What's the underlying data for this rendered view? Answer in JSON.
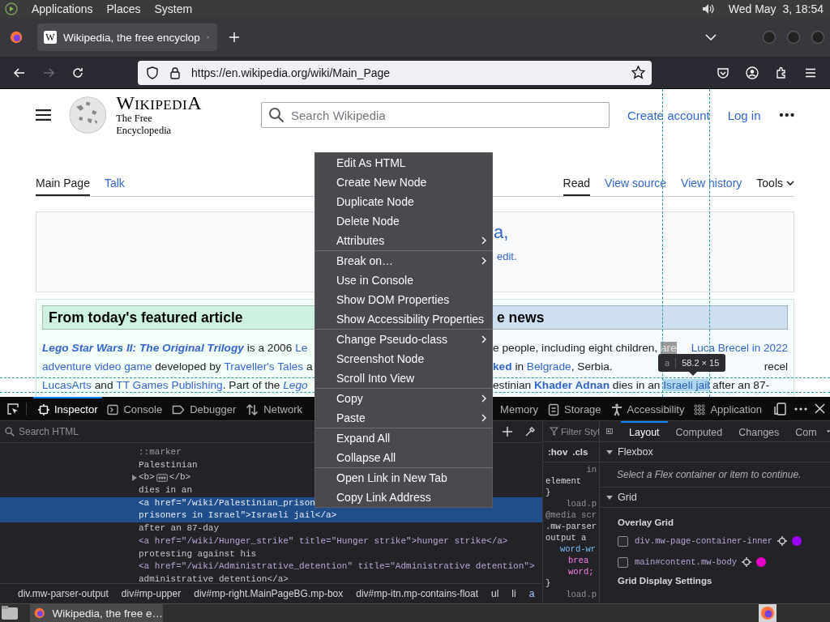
{
  "top_panel": {
    "menus": [
      "Applications",
      "Places",
      "System"
    ],
    "clock": "Wed May  3, 18:54"
  },
  "browser": {
    "tabs": [
      {
        "favicon": "W",
        "title": "Wikipedia, the free encyclop",
        "selected": true
      }
    ],
    "url": "https://en.wikipedia.org/wiki/Main_Page",
    "forward_disabled": true
  },
  "page": {
    "wordmark": "WikipediA",
    "tagline": "The Free Encyclopedia",
    "search_placeholder": "Search Wikipedia",
    "user_links": [
      "Create account",
      "Log in"
    ],
    "namespace_tabs": [
      {
        "label": "Main Page",
        "selected": true
      },
      {
        "label": "Talk",
        "selected": false
      }
    ],
    "view_tabs": [
      {
        "label": "Read",
        "selected": true
      },
      {
        "label": "View source",
        "selected": false
      },
      {
        "label": "View history",
        "selected": false
      }
    ],
    "tools_label": "Tools",
    "welcome_fragments": [
      "a,",
      "edit."
    ],
    "featured": {
      "heading": "From today's featured article",
      "lines": [
        [
          {
            "text": "Lego Star Wars II: The Original Trilogy",
            "kind": "featured"
          },
          {
            "text": " is a 2006 ",
            "kind": "plain"
          },
          {
            "text": "Le",
            "kind": "link"
          }
        ],
        [
          {
            "text": "adventure video game",
            "kind": "link"
          },
          {
            "text": " developed by ",
            "kind": "plain"
          },
          {
            "text": "Traveller's Tales",
            "kind": "link"
          },
          {
            "text": " a",
            "kind": "plain"
          }
        ],
        [
          {
            "text": "LucasArts",
            "kind": "link"
          },
          {
            "text": " and ",
            "kind": "plain"
          },
          {
            "text": "TT Games Publishing",
            "kind": "link"
          },
          {
            "text": ". Part of the ",
            "kind": "plain"
          },
          {
            "text": "Lego",
            "kind": "italic-link"
          }
        ]
      ]
    },
    "news": {
      "heading": "e news",
      "lines": [
        {
          "segments": [
            {
              "text": "e people, including eight children, ",
              "kind": "plain"
            },
            {
              "text": "are",
              "kind": "dim"
            }
          ],
          "caption": "Luca Brecel in 2022",
          "caption_is_link": true
        },
        {
          "segments": [
            {
              "text": "ked",
              "kind": "bold-link"
            },
            {
              "text": " in ",
              "kind": "plain"
            },
            {
              "text": "Belgrade",
              "kind": "link"
            },
            {
              "text": ", Serbia.",
              "kind": "plain"
            }
          ],
          "caption": "recel",
          "caption_is_link": false
        },
        {
          "segments": [
            {
              "text": "estinian ",
              "kind": "plain"
            },
            {
              "text": "Khader Adnan",
              "kind": "bold-link"
            },
            {
              "text": " dies in an ",
              "kind": "plain"
            },
            {
              "text": "Israeli jail",
              "kind": "inspected"
            },
            {
              "text": " after an 87-",
              "kind": "plain"
            }
          ]
        }
      ]
    }
  },
  "tooltip": {
    "tag": "a",
    "size": "58.2 × 15"
  },
  "devtools": {
    "tools_left": [
      {
        "label": "Inspector",
        "kind": "inspector",
        "selected": true
      },
      {
        "label": "Console",
        "kind": "console",
        "selected": false
      },
      {
        "label": "Debugger",
        "kind": "debugger",
        "selected": false
      },
      {
        "label": "Network",
        "kind": "network",
        "selected": false
      }
    ],
    "tools_right": [
      {
        "label": "Memory",
        "kind": "none",
        "selected": false
      },
      {
        "label": "Storage",
        "kind": "storage",
        "selected": false
      },
      {
        "label": "Accessibility",
        "kind": "accessibility",
        "selected": false
      },
      {
        "label": "Application",
        "kind": "application",
        "selected": false
      }
    ],
    "search_placeholder": "Search HTML",
    "markup": [
      {
        "kind": "pseudo",
        "text": "::marker",
        "selected": false
      },
      {
        "kind": "text",
        "text": "Palestinian",
        "selected": false
      },
      {
        "kind": "collapsed",
        "open_tag": "<b>",
        "close_tag": "</b>",
        "expanded": false,
        "selected": false
      },
      {
        "kind": "text",
        "text": "dies in an",
        "selected": false
      },
      {
        "kind": "tag",
        "text": "<a href=\"/wiki/Palestinian_prison",
        "selected": true
      },
      {
        "kind": "tag",
        "text": "prisoners in Israel\">Israeli jail</a>",
        "selected": true
      },
      {
        "kind": "text",
        "text": "after an 87-day",
        "selected": false
      },
      {
        "kind": "tag",
        "text": "<a href=\"/wiki/Hunger_strike\" title=\"Hunger strike\">hunger strike</a>",
        "selected": false
      },
      {
        "kind": "text",
        "text": "protesting against his",
        "selected": false
      },
      {
        "kind": "tag",
        "text": "<a href=\"/wiki/Administrative_detention\" title=\"Administrative detention\">",
        "selected": false
      },
      {
        "kind": "text",
        "text": "administrative detention</a>",
        "selected": false
      }
    ],
    "breadcrumbs": [
      {
        "label": "div.mw-parser-output",
        "selected": false
      },
      {
        "label": "div#mp-upper",
        "selected": false
      },
      {
        "label": "div#mp-right.MainPageBG.mp-box",
        "selected": false
      },
      {
        "label": "div#mp-itn.mp-contains-float",
        "selected": false
      },
      {
        "label": "ul",
        "selected": false
      },
      {
        "label": "li",
        "selected": false
      },
      {
        "label": "a",
        "selected": true
      }
    ],
    "rules": {
      "filter_placeholder": "Filter Styl",
      "toggles": [
        ":hov",
        ".cls"
      ],
      "lines": [
        {
          "kind": "source",
          "text": "in"
        },
        {
          "kind": "selector",
          "text": "element"
        },
        {
          "kind": "brace",
          "text": "}"
        },
        {
          "kind": "source",
          "text": "load.p"
        },
        {
          "kind": "media",
          "text": "@media scr"
        },
        {
          "kind": "selector",
          "text": ".mw-parser"
        },
        {
          "kind": "selector",
          "text": "output a"
        },
        {
          "kind": "property",
          "text": "word-wr"
        },
        {
          "kind": "subproperty",
          "text": "brea"
        },
        {
          "kind": "value",
          "text": "word;"
        },
        {
          "kind": "brace",
          "text": "}"
        },
        {
          "kind": "source",
          "text": "load.p"
        }
      ]
    },
    "layout": {
      "tabs": [
        {
          "label": "Layout",
          "selected": true
        },
        {
          "label": "Computed",
          "selected": false
        },
        {
          "label": "Changes",
          "selected": false
        },
        {
          "label": "Com",
          "selected": false
        }
      ],
      "flexbox": {
        "title": "Flexbox",
        "expanded": true,
        "message": "Select a Flex container or item to continue."
      },
      "grid": {
        "title": "Grid",
        "expanded": true,
        "overlay_title": "Overlay Grid",
        "grids": [
          {
            "selector": "div.mw-page-container-inner",
            "checked": false,
            "color": "#9b00ff"
          },
          {
            "selector": "main#content.mw-body",
            "checked": false,
            "color": "#e500c8"
          }
        ],
        "settings_title": "Grid Display Settings"
      }
    }
  },
  "context_menu": {
    "groups": [
      [
        {
          "label": "Edit As HTML",
          "submenu": false
        },
        {
          "label": "Create New Node",
          "submenu": false
        },
        {
          "label": "Duplicate Node",
          "submenu": false
        },
        {
          "label": "Delete Node",
          "submenu": false
        },
        {
          "label": "Attributes",
          "submenu": true
        }
      ],
      [
        {
          "label": "Break on…",
          "submenu": true
        },
        {
          "label": "Use in Console",
          "submenu": false
        },
        {
          "label": "Show DOM Properties",
          "submenu": false
        },
        {
          "label": "Show Accessibility Properties",
          "submenu": false
        }
      ],
      [
        {
          "label": "Change Pseudo-class",
          "submenu": true
        },
        {
          "label": "Screenshot Node",
          "submenu": false
        },
        {
          "label": "Scroll Into View",
          "submenu": false
        }
      ],
      [
        {
          "label": "Copy",
          "submenu": true
        },
        {
          "label": "Paste",
          "submenu": true
        }
      ],
      [
        {
          "label": "Expand All",
          "submenu": false
        },
        {
          "label": "Collapse All",
          "submenu": false
        }
      ],
      [
        {
          "label": "Open Link in New Tab",
          "submenu": false
        },
        {
          "label": "Copy Link Address",
          "submenu": false
        }
      ]
    ]
  },
  "taskbar": {
    "window": "Wikipedia, the free e…"
  }
}
